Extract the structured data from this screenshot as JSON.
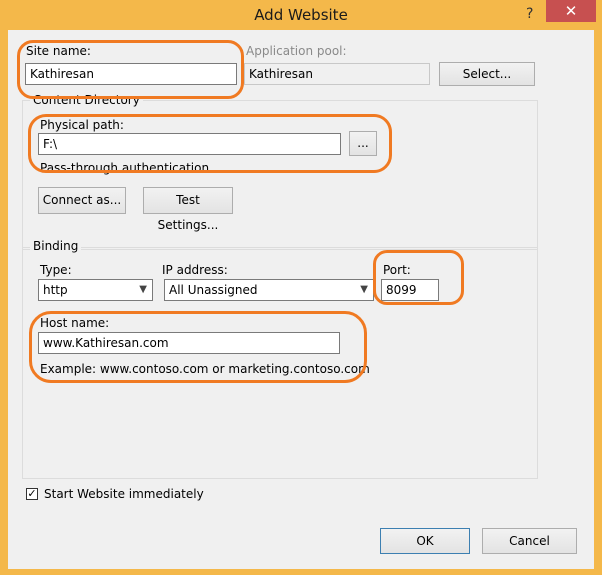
{
  "window": {
    "title": "Add Website",
    "help_glyph": "?",
    "close_glyph": "✕"
  },
  "site": {
    "site_name_label": "Site name:",
    "site_name_value": "Kathiresan",
    "app_pool_label": "Application pool:",
    "app_pool_value": "Kathiresan",
    "select_label": "Select..."
  },
  "content_directory": {
    "group_title": "Content Directory",
    "physical_path_label": "Physical path:",
    "physical_path_value": "F:\\",
    "browse_label": "...",
    "passthrough_label": "Pass-through authentication",
    "connect_as_label": "Connect as...",
    "test_settings_label": "Test Settings..."
  },
  "binding": {
    "group_title": "Binding",
    "type_label": "Type:",
    "type_value": "http",
    "ip_label": "IP address:",
    "ip_value": "All Unassigned",
    "port_label": "Port:",
    "port_value": "8099",
    "host_label": "Host name:",
    "host_value": "www.Kathiresan.com",
    "example_text": "Example: www.contoso.com or marketing.contoso.com"
  },
  "start_website": {
    "label": "Start Website immediately",
    "checked": true
  },
  "footer": {
    "ok_label": "OK",
    "cancel_label": "Cancel"
  },
  "colors": {
    "title_bar": "#f4b84a",
    "annotation_ring": "#f07a22",
    "close_button": "#c75050"
  }
}
